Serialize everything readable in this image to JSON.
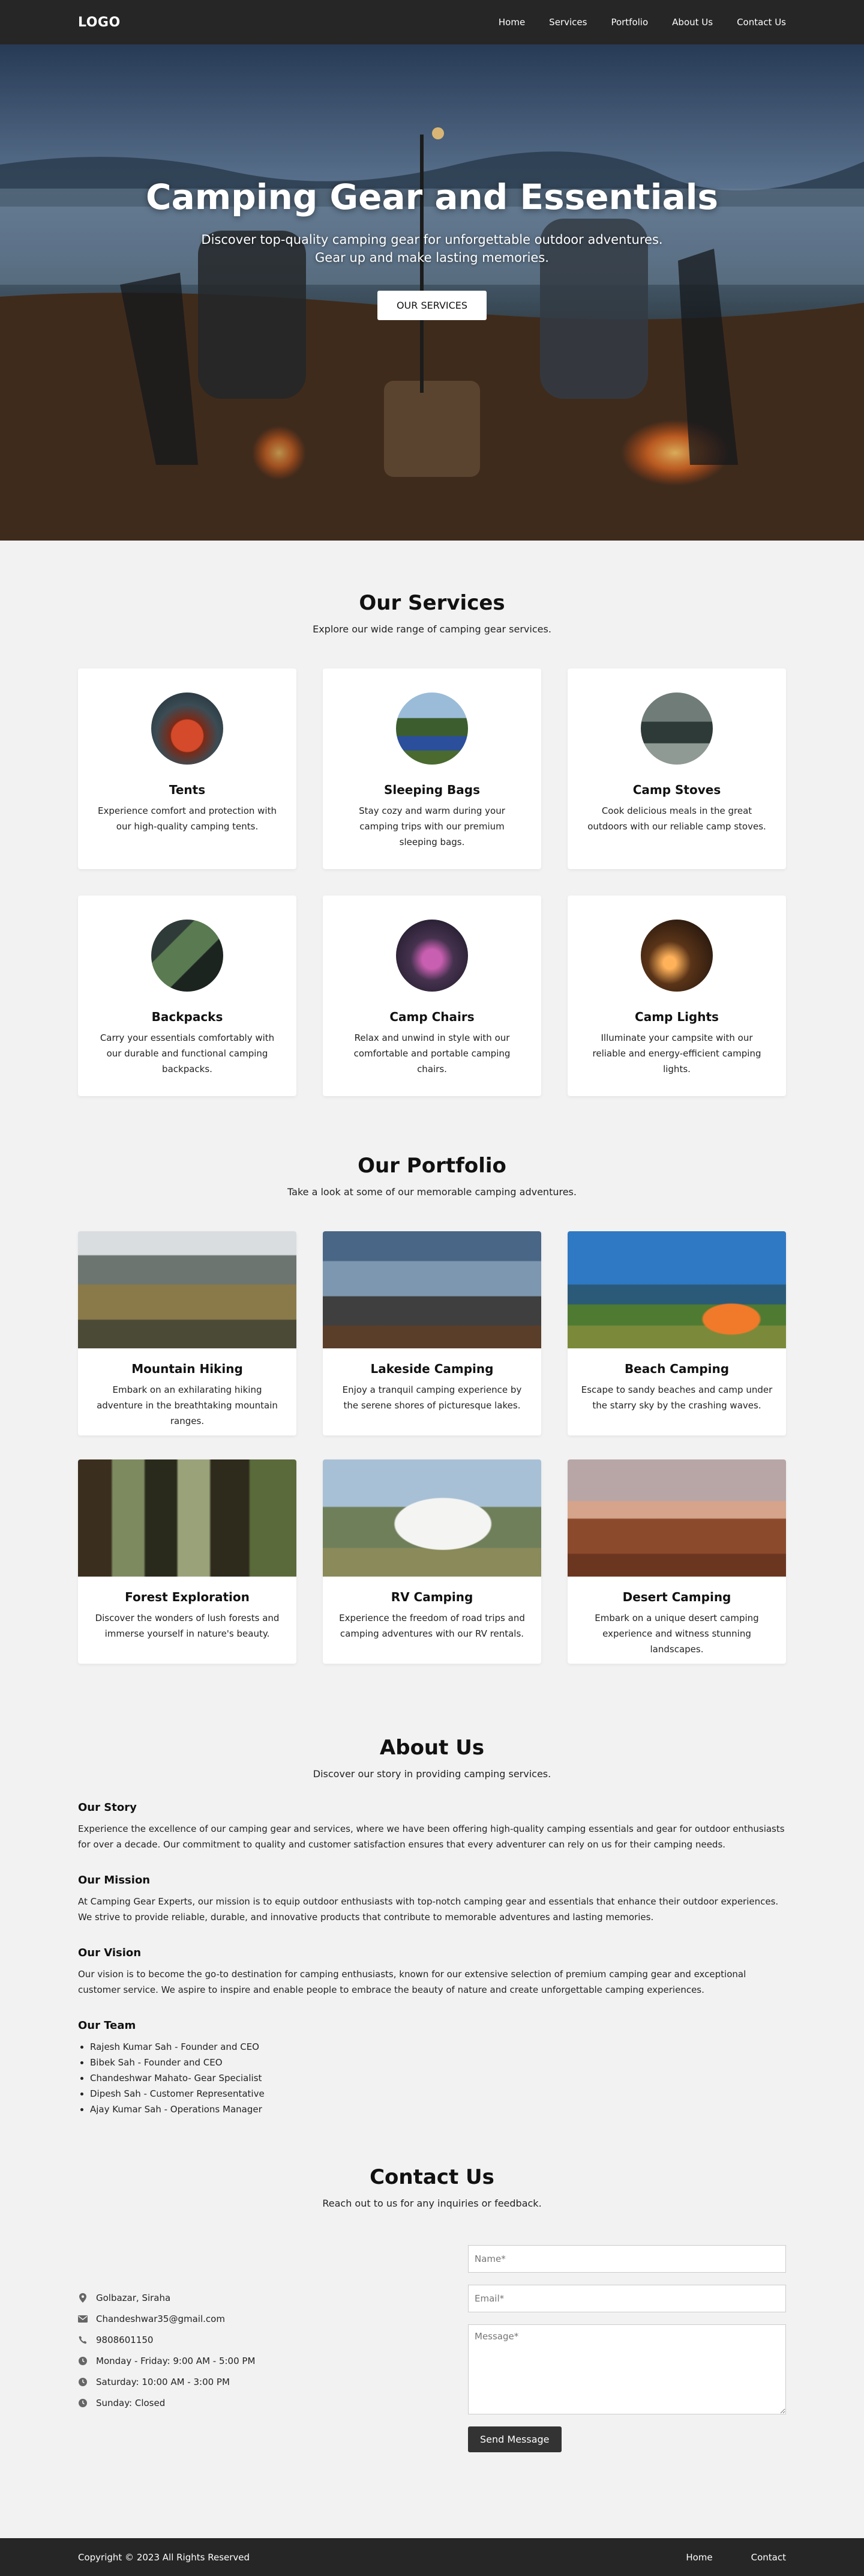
{
  "nav": {
    "logo": "LOGO",
    "links": [
      "Home",
      "Services",
      "Portfolio",
      "About Us",
      "Contact Us"
    ]
  },
  "hero": {
    "title": "Camping Gear and Essentials",
    "subtitle_line1": "Discover top-quality camping gear for unforgettable outdoor adventures.",
    "subtitle_line2": "Gear up and make lasting memories.",
    "button": "OUR SERVICES"
  },
  "services": {
    "title": "Our Services",
    "subtitle": "Explore our wide range of camping gear services.",
    "items": [
      {
        "name": "Tents",
        "desc": "Experience comfort and protection with our high-quality camping tents.",
        "icon": "tent-photo"
      },
      {
        "name": "Sleeping Bags",
        "desc": "Stay cozy and warm during your camping trips with our premium sleeping bags.",
        "icon": "sleeping-bag-photo"
      },
      {
        "name": "Camp Stoves",
        "desc": "Cook delicious meals in the great outdoors with our reliable camp stoves.",
        "icon": "camp-stove-photo"
      },
      {
        "name": "Backpacks",
        "desc": "Carry your essentials comfortably with our durable and functional camping backpacks.",
        "icon": "backpack-photo"
      },
      {
        "name": "Camp Chairs",
        "desc": "Relax and unwind in style with our comfortable and portable camping chairs.",
        "icon": "camp-chair-photo"
      },
      {
        "name": "Camp Lights",
        "desc": "Illuminate your campsite with our reliable and energy-efficient camping lights.",
        "icon": "camp-light-photo"
      }
    ]
  },
  "portfolio": {
    "title": "Our Portfolio",
    "subtitle": "Take a look at some of our memorable camping adventures.",
    "items": [
      {
        "name": "Mountain Hiking",
        "desc": "Embark on an exhilarating hiking adventure in the breathtaking mountain ranges."
      },
      {
        "name": "Lakeside Camping",
        "desc": "Enjoy a tranquil camping experience by the serene shores of picturesque lakes."
      },
      {
        "name": "Beach Camping",
        "desc": "Escape to sandy beaches and camp under the starry sky by the crashing waves."
      },
      {
        "name": "Forest Exploration",
        "desc": "Discover the wonders of lush forests and immerse yourself in nature's beauty."
      },
      {
        "name": "RV Camping",
        "desc": "Experience the freedom of road trips and camping adventures with our RV rentals."
      },
      {
        "name": "Desert Camping",
        "desc": "Embark on a unique desert camping experience and witness stunning landscapes."
      }
    ]
  },
  "about": {
    "title": "About Us",
    "subtitle": "Discover our story in providing camping services.",
    "story_title": "Our Story",
    "story": "Experience the excellence of our camping gear and services, where we have been offering high-quality camping essentials and gear for outdoor enthusiasts for over a decade. Our commitment to quality and customer satisfaction ensures that every adventurer can rely on us for their camping needs.",
    "mission_title": "Our Mission",
    "mission": "At Camping Gear Experts, our mission is to equip outdoor enthusiasts with top-notch camping gear and essentials that enhance their outdoor experiences. We strive to provide reliable, durable, and innovative products that contribute to memorable adventures and lasting memories.",
    "vision_title": "Our Vision",
    "vision": "Our vision is to become the go-to destination for camping enthusiasts, known for our extensive selection of premium camping gear and exceptional customer service. We aspire to inspire and enable people to embrace the beauty of nature and create unforgettable camping experiences.",
    "team_title": "Our Team",
    "team": [
      "Rajesh Kumar Sah - Founder and CEO",
      "Bibek Sah - Founder and CEO",
      "Chandeshwar Mahato- Gear Specialist",
      "Dipesh Sah - Customer Representative",
      "Ajay Kumar Sah - Operations Manager"
    ]
  },
  "contact": {
    "title": "Contact Us",
    "subtitle": "Reach out to us for any inquiries or feedback.",
    "info": [
      {
        "icon": "location-icon",
        "text": "Golbazar, Siraha"
      },
      {
        "icon": "mail-icon",
        "text": "Chandeshwar35@gmail.com"
      },
      {
        "icon": "phone-icon",
        "text": "9808601150"
      },
      {
        "icon": "clock-icon",
        "text": "Monday - Friday: 9:00 AM - 5:00 PM"
      },
      {
        "icon": "clock-icon",
        "text": "Saturday: 10:00 AM - 3:00 PM"
      },
      {
        "icon": "clock-icon",
        "text": "Sunday: Closed"
      }
    ],
    "form": {
      "name_placeholder": "Name*",
      "email_placeholder": "Email*",
      "message_placeholder": "Message*",
      "button": "Send Message"
    }
  },
  "footer": {
    "copyright": "Copyright © 2023 All Rights Reserved",
    "links": [
      "Home",
      "Contact"
    ]
  }
}
